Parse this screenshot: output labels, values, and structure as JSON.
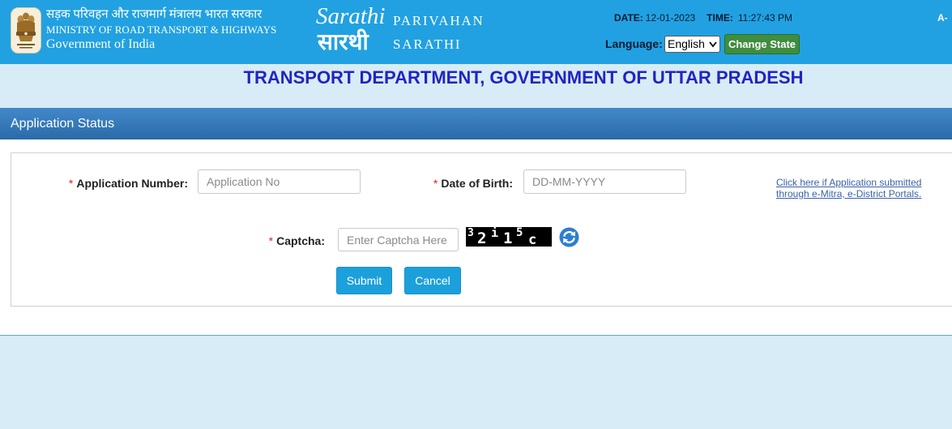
{
  "header": {
    "ministry_hindi": "सड़क परिवहन और राजमार्ग मंत्रालय भारत सरकार",
    "ministry_english": "MINISTRY OF ROAD TRANSPORT & HIGHWAYS",
    "government": "Government of India",
    "logo_script": "Sarathi",
    "logo_hindi": "सारथी",
    "app_name_line1": "PARIVAHAN",
    "app_name_line2": "SARATHI",
    "date_label": "DATE:",
    "date_value": "12-01-2023",
    "time_label": "TIME:",
    "time_value": "11:27:43 PM",
    "language_label": "Language:",
    "language_selected": "English",
    "change_state_label": "Change State",
    "text_size_decrease": "A-"
  },
  "page_title": "TRANSPORT DEPARTMENT, GOVERNMENT OF UTTAR PRADESH",
  "section_title": "Application Status",
  "form": {
    "required_marker": "*",
    "application_number": {
      "label": "Application Number:",
      "value": "",
      "placeholder": "Application No"
    },
    "date_of_birth": {
      "label": "Date of Birth:",
      "value": "",
      "placeholder": "DD-MM-YYYY"
    },
    "captcha": {
      "label": "Captcha:",
      "value": "",
      "placeholder": "Enter Captcha Here",
      "image_chars": [
        "3",
        "2",
        "i",
        "1",
        "5",
        "c"
      ]
    },
    "portal_link": {
      "line1": "Click here if Application submitted",
      "line2": "through e-Mitra, e-District Portals."
    },
    "submit_label": "Submit",
    "cancel_label": "Cancel"
  },
  "icons": {
    "emblem": "national-emblem-icon",
    "language_dropdown": "chevron-down-icon",
    "captcha_refresh": "refresh-icon"
  },
  "colors": {
    "header_bg": "#21a1e1",
    "page_bg": "#d8ecf7",
    "title_text": "#2323c3",
    "section_bar": "#4289c9",
    "section_bar_dark": "#2b6aa9",
    "primary_button": "#1ca0db",
    "change_state_button": "#3f8d3f",
    "required_marker": "#e0201e",
    "link_text": "#3a62a6",
    "divider": "#5aa6d6",
    "header_dark_text": "#0b1a33"
  }
}
